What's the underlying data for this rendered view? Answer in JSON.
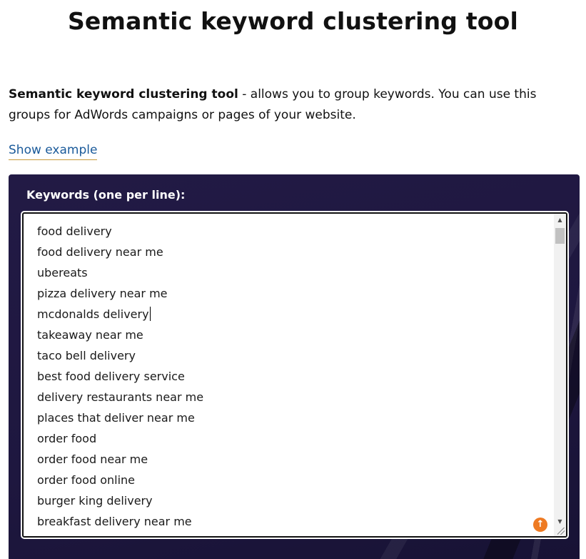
{
  "page": {
    "title": "Semantic keyword clustering tool"
  },
  "description": {
    "tool_name": "Semantic keyword clustering tool",
    "text": " - allows you to group keywords. You can use this groups for AdWords campaigns or pages of your website."
  },
  "show_example": {
    "label": "Show example"
  },
  "form": {
    "keywords_label": "Keywords (one per line):",
    "keywords": [
      "food delivery",
      "food delivery near me",
      "ubereats",
      "pizza delivery near me",
      "mcdonalds delivery",
      "takeaway near me",
      "taco bell delivery",
      "best food delivery service",
      "delivery restaurants near me",
      "places that deliver near me",
      "order food",
      "order food near me",
      "order food online",
      "burger king delivery",
      "breakfast delivery near me"
    ]
  },
  "icons": {
    "scroll_up": "triangle-up-icon",
    "scroll_down": "triangle-down-icon",
    "back_to_top": "arrow-up-circle-icon",
    "resize": "resize-grip-icon"
  },
  "colors": {
    "panel_bg": "#1e173f",
    "link": "#1a5a9a",
    "link_underline": "#c89a3a",
    "back_to_top": "#ee7a22"
  }
}
